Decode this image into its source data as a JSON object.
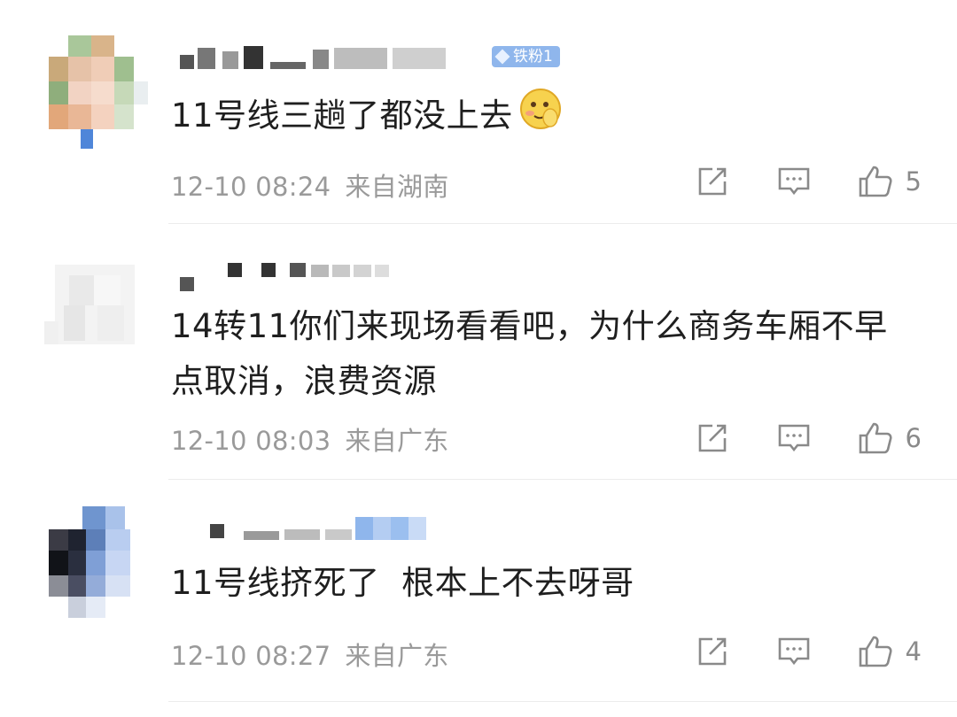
{
  "comments": [
    {
      "badge": "铁粉1",
      "text": "11号线三趟了都没上去",
      "emoji": "shy-smile-emoji",
      "date": "12-10 08:24",
      "location": "来自湖南",
      "likes": "5"
    },
    {
      "text": "14转11你们来现场看看吧，为什么商务车厢不早点取消，浪费资源",
      "date": "12-10 08:03",
      "location": "来自广东",
      "likes": "6"
    },
    {
      "text": "11号线挤死了  根本上不去呀哥",
      "date": "12-10 08:27",
      "location": "来自广东",
      "likes": "4"
    }
  ],
  "icons": {
    "share": "share-icon",
    "reply": "comment-icon",
    "like": "thumbs-up-icon"
  },
  "colors": {
    "meta_text": "#9a9a9a",
    "badge_bg": "#8fb6ec",
    "icon_stroke": "#8a8a8a"
  }
}
